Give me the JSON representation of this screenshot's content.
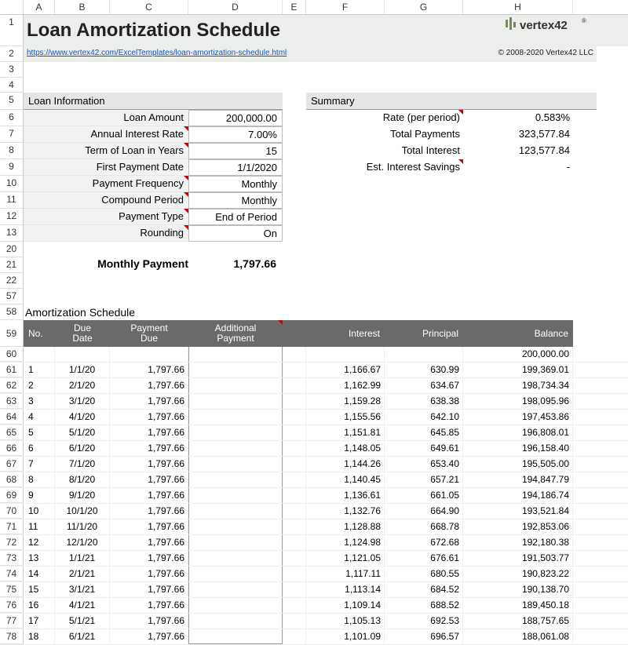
{
  "columns": [
    "A",
    "B",
    "C",
    "D",
    "E",
    "F",
    "G",
    "H"
  ],
  "title": "Loan Amortization Schedule",
  "url": "https://www.vertex42.com/ExcelTemplates/loan-amortization-schedule.html",
  "copyright": "© 2008-2020 Vertex42 LLC",
  "logo_text": "vertex42",
  "loan_info": {
    "heading": "Loan Information",
    "rows": [
      {
        "label": "Loan Amount",
        "value": "200,000.00",
        "mark": false
      },
      {
        "label": "Annual Interest Rate",
        "value": "7.00%",
        "mark": true
      },
      {
        "label": "Term of Loan in Years",
        "value": "15",
        "mark": true
      },
      {
        "label": "First Payment Date",
        "value": "1/1/2020",
        "mark": false
      },
      {
        "label": "Payment Frequency",
        "value": "Monthly",
        "mark": true
      },
      {
        "label": "Compound Period",
        "value": "Monthly",
        "mark": true
      },
      {
        "label": "Payment Type",
        "value": "End of Period",
        "mark": true
      },
      {
        "label": "Rounding",
        "value": "On",
        "mark": true
      }
    ]
  },
  "summary": {
    "heading": "Summary",
    "rows": [
      {
        "label": "Rate (per period)",
        "value": "0.583%",
        "mark": true
      },
      {
        "label": "Total Payments",
        "value": "323,577.84",
        "mark": false
      },
      {
        "label": "Total Interest",
        "value": "123,577.84",
        "mark": false
      },
      {
        "label": "Est. Interest Savings",
        "value": "-",
        "mark": true
      }
    ]
  },
  "monthly_payment": {
    "label": "Monthly Payment",
    "value": "1,797.66"
  },
  "schedule_title": "Amortization Schedule",
  "sched_headers": {
    "no": "No.",
    "date1": "Due",
    "date2": "Date",
    "pay1": "Payment",
    "pay2": "Due",
    "add1": "Additional",
    "add2": "Payment",
    "interest": "Interest",
    "principal": "Principal",
    "balance": "Balance"
  },
  "initial_balance": "200,000.00",
  "row_numbers": {
    "info_start": 5,
    "payment": 21,
    "gap": [
      "20",
      "21",
      "22",
      "57"
    ],
    "sched_title": 58,
    "sched_header": 59,
    "sched_first": 60
  },
  "schedule": [
    {
      "rn": "61",
      "no": "1",
      "date": "1/1/20",
      "pay": "1,797.66",
      "interest": "1,166.67",
      "principal": "630.99",
      "balance": "199,369.01"
    },
    {
      "rn": "62",
      "no": "2",
      "date": "2/1/20",
      "pay": "1,797.66",
      "interest": "1,162.99",
      "principal": "634.67",
      "balance": "198,734.34"
    },
    {
      "rn": "63",
      "no": "3",
      "date": "3/1/20",
      "pay": "1,797.66",
      "interest": "1,159.28",
      "principal": "638.38",
      "balance": "198,095.96"
    },
    {
      "rn": "64",
      "no": "4",
      "date": "4/1/20",
      "pay": "1,797.66",
      "interest": "1,155.56",
      "principal": "642.10",
      "balance": "197,453.86"
    },
    {
      "rn": "65",
      "no": "5",
      "date": "5/1/20",
      "pay": "1,797.66",
      "interest": "1,151.81",
      "principal": "645.85",
      "balance": "196,808.01"
    },
    {
      "rn": "66",
      "no": "6",
      "date": "6/1/20",
      "pay": "1,797.66",
      "interest": "1,148.05",
      "principal": "649.61",
      "balance": "196,158.40"
    },
    {
      "rn": "67",
      "no": "7",
      "date": "7/1/20",
      "pay": "1,797.66",
      "interest": "1,144.26",
      "principal": "653.40",
      "balance": "195,505.00"
    },
    {
      "rn": "68",
      "no": "8",
      "date": "8/1/20",
      "pay": "1,797.66",
      "interest": "1,140.45",
      "principal": "657.21",
      "balance": "194,847.79"
    },
    {
      "rn": "69",
      "no": "9",
      "date": "9/1/20",
      "pay": "1,797.66",
      "interest": "1,136.61",
      "principal": "661.05",
      "balance": "194,186.74"
    },
    {
      "rn": "70",
      "no": "10",
      "date": "10/1/20",
      "pay": "1,797.66",
      "interest": "1,132.76",
      "principal": "664.90",
      "balance": "193,521.84"
    },
    {
      "rn": "71",
      "no": "11",
      "date": "11/1/20",
      "pay": "1,797.66",
      "interest": "1,128.88",
      "principal": "668.78",
      "balance": "192,853.06"
    },
    {
      "rn": "72",
      "no": "12",
      "date": "12/1/20",
      "pay": "1,797.66",
      "interest": "1,124.98",
      "principal": "672.68",
      "balance": "192,180.38"
    },
    {
      "rn": "73",
      "no": "13",
      "date": "1/1/21",
      "pay": "1,797.66",
      "interest": "1,121.05",
      "principal": "676.61",
      "balance": "191,503.77"
    },
    {
      "rn": "74",
      "no": "14",
      "date": "2/1/21",
      "pay": "1,797.66",
      "interest": "1,117.11",
      "principal": "680.55",
      "balance": "190,823.22"
    },
    {
      "rn": "75",
      "no": "15",
      "date": "3/1/21",
      "pay": "1,797.66",
      "interest": "1,113.14",
      "principal": "684.52",
      "balance": "190,138.70"
    },
    {
      "rn": "76",
      "no": "16",
      "date": "4/1/21",
      "pay": "1,797.66",
      "interest": "1,109.14",
      "principal": "688.52",
      "balance": "189,450.18"
    },
    {
      "rn": "77",
      "no": "17",
      "date": "5/1/21",
      "pay": "1,797.66",
      "interest": "1,105.13",
      "principal": "692.53",
      "balance": "188,757.65"
    },
    {
      "rn": "78",
      "no": "18",
      "date": "6/1/21",
      "pay": "1,797.66",
      "interest": "1,101.09",
      "principal": "696.57",
      "balance": "188,061.08"
    }
  ]
}
